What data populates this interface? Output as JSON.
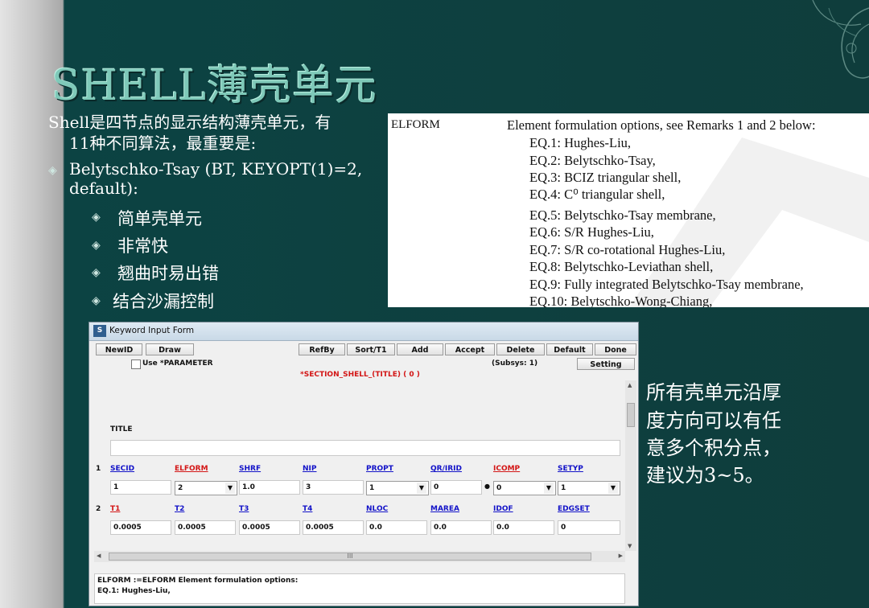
{
  "slide": {
    "title": "SHELL薄壳单元",
    "intro": [
      "Shell是四节点的显示结构薄壳单元，有",
      "11种不同算法，最重要是:"
    ],
    "bullet_main": [
      "Belytschko-Tsay (BT, KEYOPT(1)=2,",
      "default):"
    ],
    "sub_bullets": [
      "简单壳单元",
      "非常快",
      "翘曲时易出错",
      "结合沙漏控制"
    ],
    "right_text": [
      "所有壳单元沿厚",
      "度方向可以有任",
      "意多个积分点，",
      "建议为3~5。"
    ],
    "bullet_glyph": "◈"
  },
  "formula_box": {
    "field": "ELFORM",
    "heading": "Element formulation options, see Remarks 1 and 2 below:",
    "options": [
      "EQ.1:  Hughes-Liu,",
      "EQ.2:  Belytschko-Tsay,",
      "EQ.3:  BCIZ triangular shell,",
      "EQ.4:  C⁰ triangular shell,",
      "EQ.5:  Belytschko-Tsay membrane,",
      "EQ.6:  S/R Hughes-Liu,",
      "EQ.7:    S/R co-rotational Hughes-Liu,",
      "EQ.8:    Belytschko-Leviathan shell,",
      "EQ.9:    Fully integrated Belytschko-Tsay membrane,",
      "EQ.10:  Belytschko-Wong-Chiang,"
    ]
  },
  "window": {
    "title": "Keyword Input Form",
    "toolbar": [
      "NewID",
      "Draw",
      "RefBy",
      "Sort/T1",
      "Add",
      "Accept",
      "Delete",
      "Default",
      "Done"
    ],
    "use_parameter": "Use *PARAMETER",
    "subsys": "(Subsys: 1)",
    "setting": "Setting",
    "keyword": "*SECTION_SHELL_(TITLE)  ( 0 )",
    "title_label": "TITLE",
    "title_value": "",
    "row1": {
      "num": "1",
      "labels": [
        "SECID",
        "ELFORM",
        "SHRF",
        "NIP",
        "PROPT",
        "QR/IRID",
        "ICOMP",
        "SETYP"
      ],
      "values": [
        "1",
        "2",
        "1.0",
        "3",
        "1",
        "0",
        "0",
        "1"
      ],
      "dot": "●"
    },
    "row2": {
      "num": "2",
      "labels": [
        "T1",
        "T2",
        "T3",
        "T4",
        "NLOC",
        "MAREA",
        "IDOF",
        "EDGSET"
      ],
      "values": [
        "0.0005",
        "0.0005",
        "0.0005",
        "0.0005",
        "0.0",
        "0.0",
        "0.0",
        "0"
      ]
    },
    "scroll_grip": "III",
    "help": [
      "ELFORM :=ELFORM Element formulation options:",
      "EQ.1: Hughes-Liu,"
    ],
    "colors": {
      "link": "#1212c8",
      "required": "#d31515",
      "keyword": "#d31515"
    }
  }
}
